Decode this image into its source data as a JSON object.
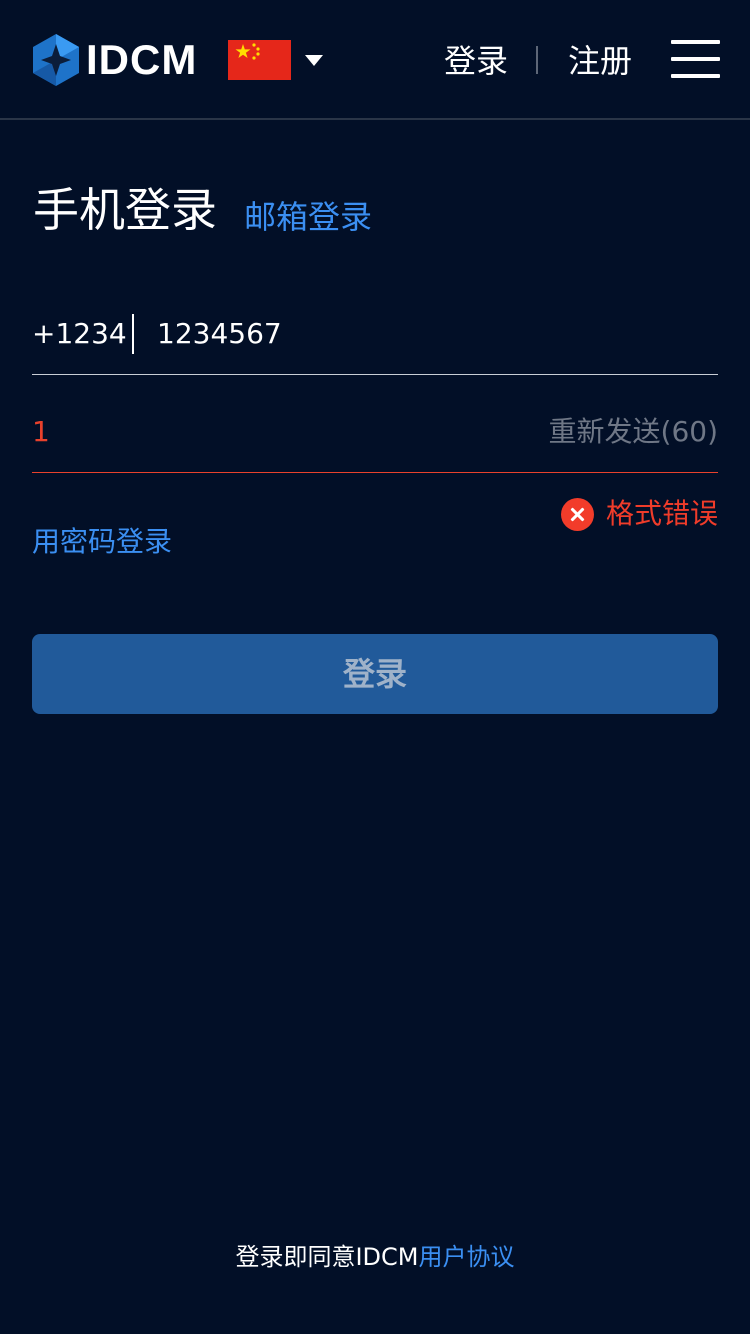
{
  "header": {
    "brand": "IDCM",
    "nav_login": "登录",
    "nav_register": "注册",
    "icons": {
      "logo": "idcm-hexagon-logo",
      "flag": "china-flag-icon",
      "caret": "caret-down-icon",
      "menu": "hamburger-menu-icon"
    }
  },
  "login": {
    "title": "手机登录",
    "alt_method": "邮箱登录",
    "country_code": "+1234",
    "phone_value": "1234567",
    "code_value": "1",
    "resend_label": "重新发送(60)",
    "error_text": "格式错误",
    "password_login_link": "用密码登录",
    "submit_label": "登录"
  },
  "footer": {
    "agreement_prefix": "登录即同意IDCM",
    "agreement_link": "用户协议"
  },
  "colors": {
    "background": "#020f27",
    "accent": "#3b8ff2",
    "error": "#f03c2a",
    "button": "#215a9a"
  }
}
